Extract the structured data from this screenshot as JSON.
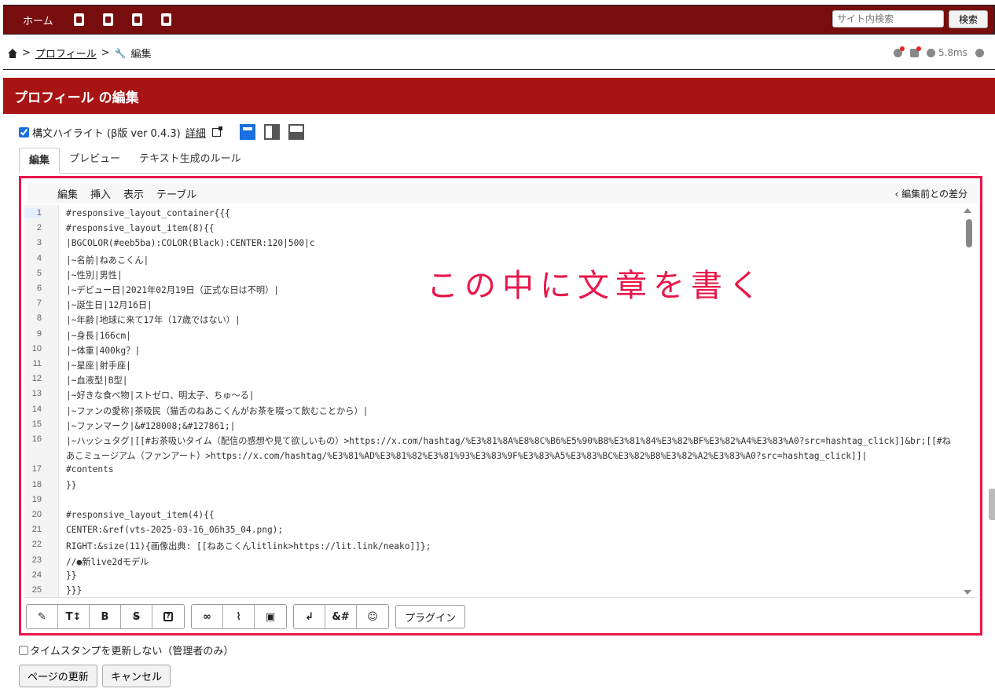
{
  "topbar": {
    "home": "ホーム",
    "search_placeholder": "サイト内検索",
    "search_button": "検索"
  },
  "breadcrumb": {
    "sep": ">",
    "page": "プロフィール",
    "action": "編集"
  },
  "status": {
    "time": "5.8ms"
  },
  "title": "プロフィール の編集",
  "highlight": {
    "label": "構文ハイライト (β版 ver 0.4.3)",
    "detail": "詳細"
  },
  "tabs": [
    "編集",
    "プレビュー",
    "テキスト生成のルール"
  ],
  "menu": [
    "編集",
    "挿入",
    "表示",
    "テーブル"
  ],
  "diff": "‹ 編集前との差分",
  "annotation": "この中に文章を書く",
  "lines": [
    {
      "n": "1",
      "t": "#responsive_layout_container{{{"
    },
    {
      "n": "2",
      "t": "#responsive_layout_item(8){{"
    },
    {
      "n": "3",
      "t": "|BGCOLOR(#eeb5ba):COLOR(Black):CENTER:120|500|c"
    },
    {
      "n": "4",
      "t": "|~名前|ねあこくん|"
    },
    {
      "n": "5",
      "t": "|~性別|男性|"
    },
    {
      "n": "6",
      "t": "|~デビュー日|2021年02月19日（正式な日は不明）|"
    },
    {
      "n": "7",
      "t": "|~誕生日|12月16日|"
    },
    {
      "n": "8",
      "t": "|~年齢|地球に来て17年（17歳ではない）|"
    },
    {
      "n": "9",
      "t": "|~身長|166cm|"
    },
    {
      "n": "10",
      "t": "|~体重|400kg？|"
    },
    {
      "n": "11",
      "t": "|~星座|射手座|"
    },
    {
      "n": "12",
      "t": "|~血液型|B型|"
    },
    {
      "n": "13",
      "t": "|~好きな食べ物|ストゼロ、明太子、ちゅ～る|"
    },
    {
      "n": "14",
      "t": "|~ファンの愛称|茶吸民（猫舌のねあこくんがお茶を啜って飲むことから）|"
    },
    {
      "n": "15",
      "t": "|~ファンマーク|&#128008;&#127861;|"
    },
    {
      "n": "16",
      "t": "|~ハッシュタグ|[[#お茶吸いタイム（配信の感想や見て欲しいもの）>https://x.com/hashtag/%E3%81%8A%E8%8C%B6%E5%90%B8%E3%81%84%E3%82%BF%E3%82%A4%E3%83%A0?src=hashtag_click]]&br;[[#ね"
    },
    {
      "n": "",
      "t": "あこミュージアム（ファンアート）>https://x.com/hashtag/%E3%81%AD%E3%81%82%E3%81%93%E3%83%9F%E3%83%A5%E3%83%BC%E3%82%B8%E3%82%A2%E3%83%A0?src=hashtag_click]]|"
    },
    {
      "n": "17",
      "t": "#contents"
    },
    {
      "n": "18",
      "t": "}}"
    },
    {
      "n": "19",
      "t": ""
    },
    {
      "n": "20",
      "t": "#responsive_layout_item(4){{"
    },
    {
      "n": "21",
      "t": "CENTER:&ref(vts-2025-03-16_06h35_04.png);"
    },
    {
      "n": "22",
      "t": "RIGHT:&size(11){画像出典: [[ねあこくんlitlink>https://lit.link/neako]]};"
    },
    {
      "n": "23",
      "t": "//●新live2dモデル"
    },
    {
      "n": "24",
      "t": "}}"
    },
    {
      "n": "25",
      "t": "}}}"
    }
  ],
  "toolbar": {
    "g1": [
      "✎",
      "T↕",
      "B",
      "S",
      "?"
    ],
    "g2": [
      "∞",
      "⌇",
      "▣"
    ],
    "g3": [
      "↲",
      "&#",
      "☺"
    ],
    "plugin": "プラグイン"
  },
  "timestamp_label": "タイムスタンプを更新しない（管理者のみ）",
  "buttons": {
    "update": "ページの更新",
    "cancel": "キャンセル"
  }
}
